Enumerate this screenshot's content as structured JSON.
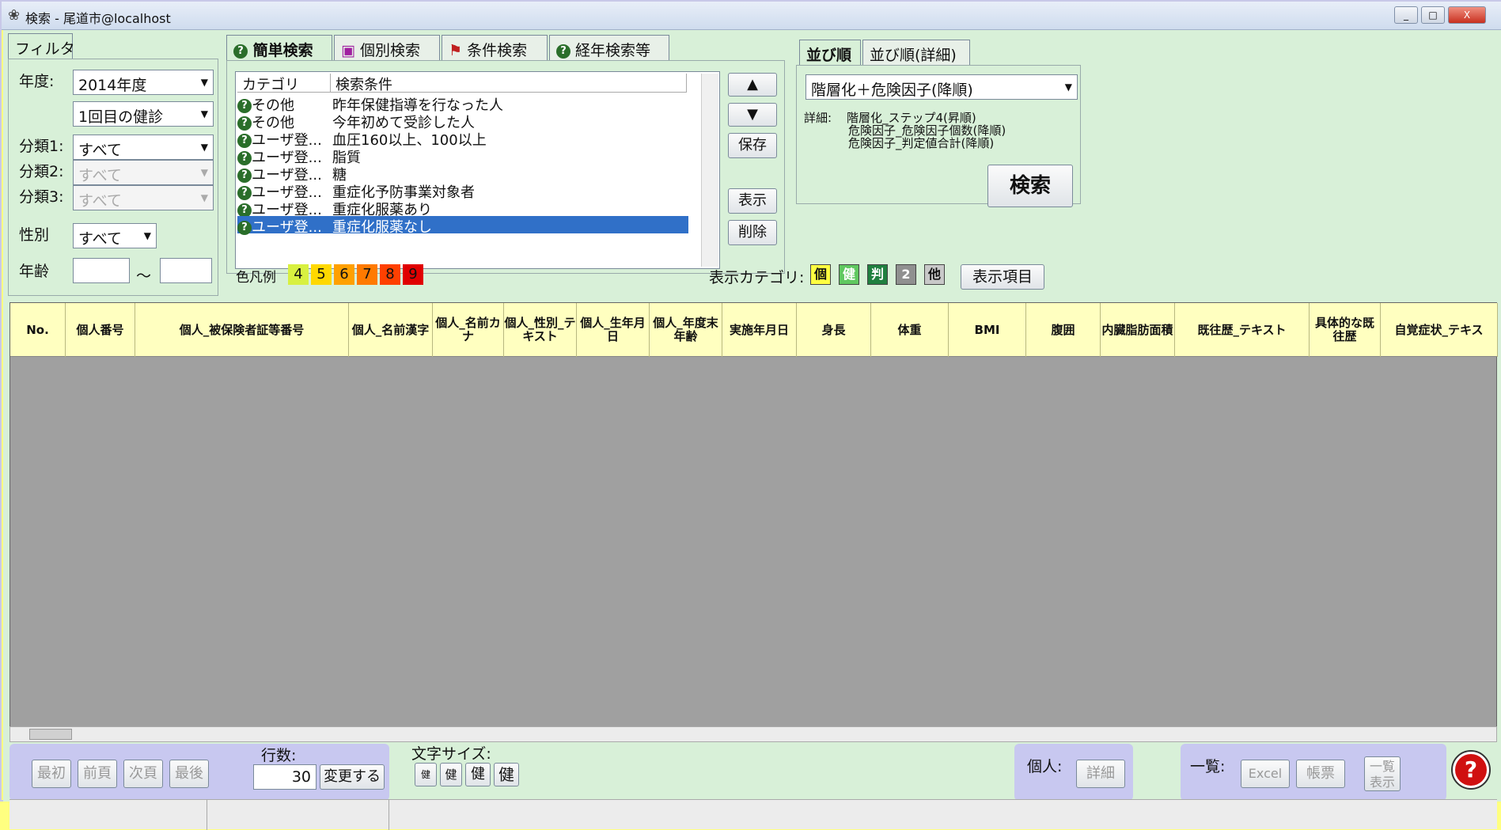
{
  "window": {
    "title": "検索 - 尾道市@localhost",
    "controls": [
      "_",
      "□",
      "X"
    ]
  },
  "filter": {
    "tab": "フィルタ",
    "year_label": "年度:",
    "year_value": "2014年度",
    "exam_value": "1回目の健診",
    "cat1_label": "分類1:",
    "cat1_value": "すべて",
    "cat2_label": "分類2:",
    "cat2_value": "すべて",
    "cat3_label": "分類3:",
    "cat3_value": "すべて",
    "sex_label": "性別",
    "sex_value": "すべて",
    "age_label": "年齢",
    "age_tilde": "～"
  },
  "search_tabs": [
    "簡単検索",
    "個別検索",
    "条件検索",
    "経年検索等"
  ],
  "query_list": {
    "headers": [
      "カテゴリ",
      "検索条件"
    ],
    "rows": [
      {
        "cat": "その他",
        "cond": "昨年保健指導を行なった人"
      },
      {
        "cat": "その他",
        "cond": "今年初めて受診した人"
      },
      {
        "cat": "ユーザ登...",
        "cond": "血圧160以上、100以上"
      },
      {
        "cat": "ユーザ登...",
        "cond": "脂質"
      },
      {
        "cat": "ユーザ登...",
        "cond": "糖"
      },
      {
        "cat": "ユーザ登...",
        "cond": "重症化予防事業対象者"
      },
      {
        "cat": "ユーザ登...",
        "cond": "重症化服薬あり"
      },
      {
        "cat": "ユーザ登...",
        "cond": "重症化服薬なし"
      }
    ]
  },
  "list_buttons": {
    "up": "▲",
    "down": "▼",
    "save": "保存",
    "show": "表示",
    "delete": "削除"
  },
  "color_legend": {
    "label": "色凡例",
    "items": [
      {
        "n": "4",
        "color": "#d8f040"
      },
      {
        "n": "5",
        "color": "#ffd800"
      },
      {
        "n": "6",
        "color": "#ffa000"
      },
      {
        "n": "7",
        "color": "#ff7a00"
      },
      {
        "n": "8",
        "color": "#ff4000"
      },
      {
        "n": "9",
        "color": "#e00000"
      }
    ]
  },
  "sort": {
    "tabs": [
      "並び順",
      "並び順(詳細)"
    ],
    "value": "階層化＋危険因子(降順)",
    "detail_label": "詳細:",
    "detail_lines": [
      "階層化_ステップ4(昇順)",
      "危険因子_危険因子個数(降順)",
      "危険因子_判定値合計(降順)"
    ],
    "search_button": "検索"
  },
  "display_category": {
    "label": "表示カテゴリ:",
    "icons": [
      "個",
      "健",
      "判",
      "2",
      "他"
    ],
    "button": "表示項目"
  },
  "grid_columns": [
    "No.",
    "個人番号",
    "個人_被保険者証等番号",
    "個人_名前漢字",
    "個人_名前カナ",
    "個人_性別_テキスト",
    "個人_生年月日",
    "個人_年度末年齢",
    "実施年月日",
    "身長",
    "体重",
    "BMI",
    "腹囲",
    "内臓脂肪面積",
    "既往歴_テキスト",
    "具体的な既往歴",
    "自覚症状_テキス"
  ],
  "paging": {
    "first": "最初",
    "prev": "前頁",
    "next": "次頁",
    "last": "最後",
    "rows_label": "行数:",
    "rows_value": "30",
    "change": "変更する"
  },
  "font_size": {
    "label": "文字サイズ:",
    "options": [
      "健",
      "健",
      "健",
      "健"
    ]
  },
  "person": {
    "label": "個人:",
    "detail": "詳細"
  },
  "list": {
    "label": "一覧:",
    "excel": "Excel",
    "report": "帳票",
    "list_show": "一覧表示"
  },
  "help": "?"
}
